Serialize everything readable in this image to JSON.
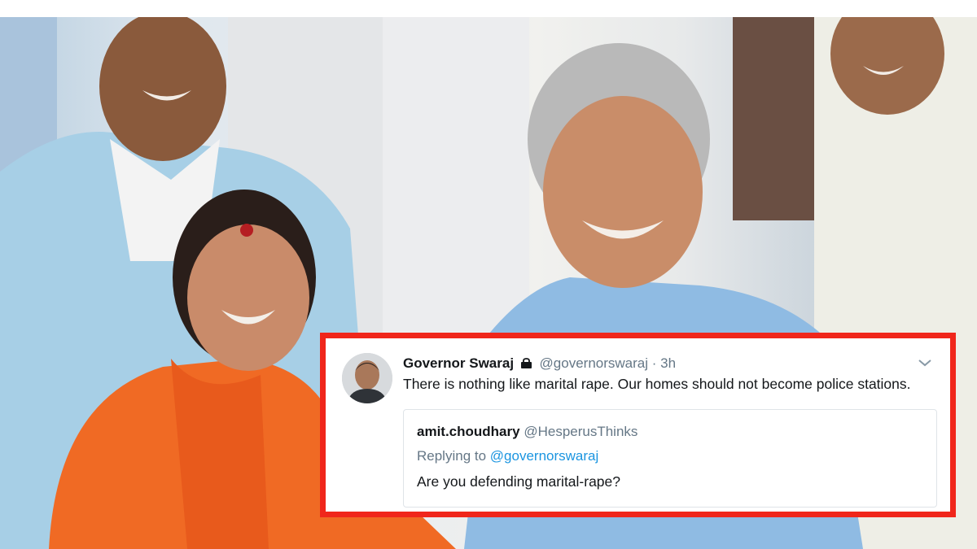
{
  "tweet": {
    "author_name": "Governor Swaraj",
    "author_handle": "@governorswaraj",
    "separator": "·",
    "time": "3h",
    "text": "There is nothing like marital rape. Our homes should not become police stations.",
    "icons": [
      "lock-icon",
      "chevron-down-icon"
    ]
  },
  "quoted_tweet": {
    "author_name": "amit.choudhary",
    "author_handle": "@HesperusThinks",
    "replying_prefix": "Replying to",
    "replying_handle": "@governorswaraj",
    "text": "Are you defending marital-rape?"
  },
  "colors": {
    "frame_border": "#f0261b",
    "link": "#1b95e0",
    "secondary_text": "#657786"
  }
}
